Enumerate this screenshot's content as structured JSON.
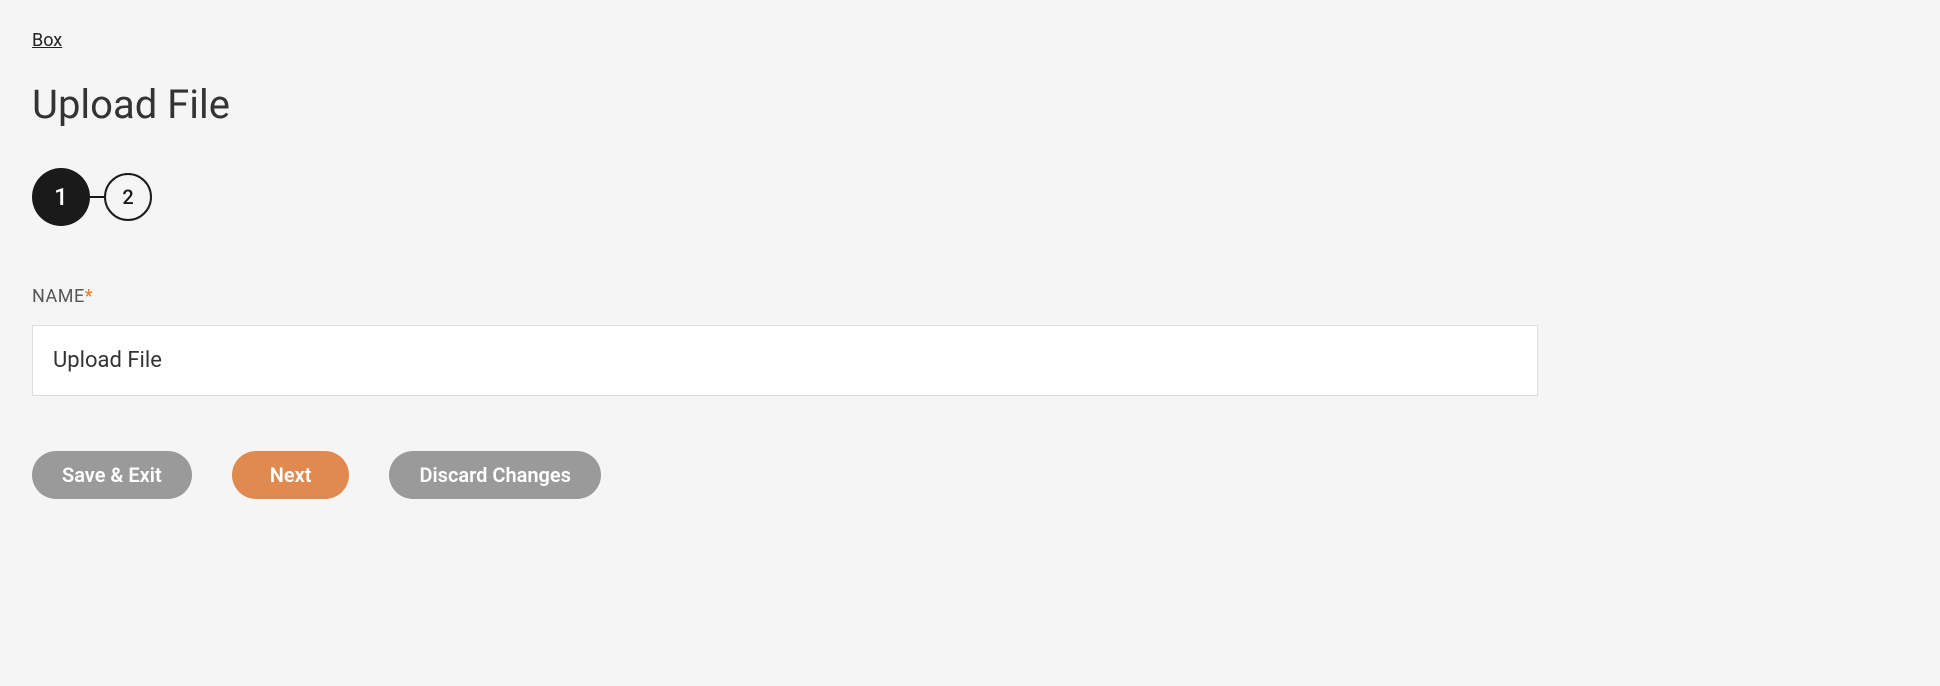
{
  "breadcrumb": {
    "label": "Box"
  },
  "page": {
    "title": "Upload File"
  },
  "stepper": {
    "steps": [
      "1",
      "2"
    ],
    "active_index": 0
  },
  "form": {
    "name_field": {
      "label": "NAME",
      "required_marker": "*",
      "value": "Upload File"
    }
  },
  "actions": {
    "save_exit": "Save & Exit",
    "next": "Next",
    "discard": "Discard Changes"
  }
}
